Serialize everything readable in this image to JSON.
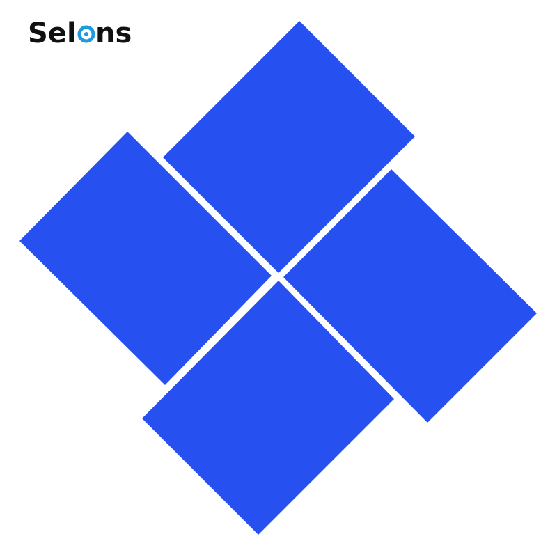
{
  "brand": {
    "name": "Selens",
    "prefix": "Sel",
    "suffix": "ns",
    "text_color": "#111111",
    "accent_color": "#1e9be0"
  },
  "product": {
    "panel_count": 4,
    "panel_color": "#2750f0",
    "background_color": "#ffffff"
  }
}
